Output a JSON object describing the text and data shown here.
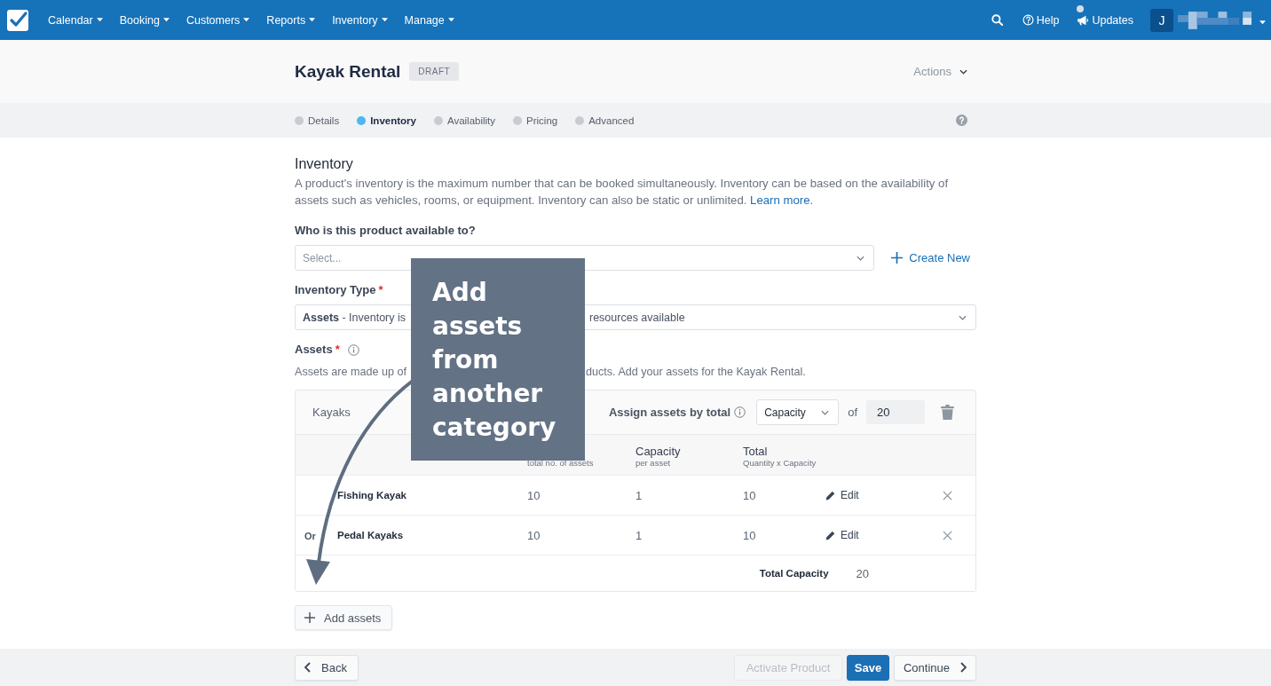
{
  "nav": {
    "menu": [
      "Calendar",
      "Booking",
      "Customers",
      "Reports",
      "Inventory",
      "Manage"
    ],
    "help": "Help",
    "updates": {
      "label": "Updates",
      "unread": true
    },
    "avatar": "J"
  },
  "header": {
    "title": "Kayak Rental",
    "badge": "DRAFT",
    "actions": "Actions"
  },
  "steps": [
    {
      "label": "Details",
      "selected": false
    },
    {
      "label": "Inventory",
      "selected": true
    },
    {
      "label": "Availability",
      "selected": false
    },
    {
      "label": "Pricing",
      "selected": false
    },
    {
      "label": "Advanced",
      "selected": false
    }
  ],
  "section": {
    "title": "Inventory",
    "description": "A product's inventory is the maximum number that can be booked simultaneously. Inventory can be based on the availability of assets such as vehicles, rooms, or equipment. Inventory can also be static or unlimited.",
    "link": "Learn more",
    "description_end": "."
  },
  "audience": {
    "label": "Who is this product available to?",
    "placeholder": "Select...",
    "create_new": "Create New"
  },
  "inventory_type": {
    "label": "Inventory Type",
    "required_mark": "*",
    "value_left": "**Assets** - Inventory is",
    "value_right": "resources available"
  },
  "assets": {
    "label": "Assets",
    "required_mark": "*",
    "hint_left": "Assets are made up of",
    "hint_right": "ducts. Add your assets for the Kayak Rental."
  },
  "asset_group": {
    "name": "Kayaks",
    "assign_label": "Assign assets by total",
    "assign_by": "Capacity",
    "of": "of",
    "total": "20",
    "columns": [
      {
        "subtitle": "total no. of assets"
      },
      {
        "title": "Capacity",
        "subtitle": "per asset"
      },
      {
        "title": "Total",
        "subtitle": "Quantity x Capacity"
      }
    ],
    "rows": [
      {
        "name": "Fishing Kayak",
        "quantity": "10",
        "capacity": "1",
        "total": "10",
        "edit": "Edit"
      },
      {
        "prefix": "Or",
        "name": "Pedal Kayaks",
        "quantity": "10",
        "capacity": "1",
        "total": "10",
        "edit": "Edit"
      }
    ],
    "total_label": "Total Capacity",
    "total_value": "20"
  },
  "add_assets": "Add assets",
  "footer": {
    "back": "Back",
    "activate": {
      "label": "Activate Product",
      "disabled": true
    },
    "save": "Save",
    "continue": "Continue"
  },
  "callout": {
    "text": "Add assets from another category"
  }
}
